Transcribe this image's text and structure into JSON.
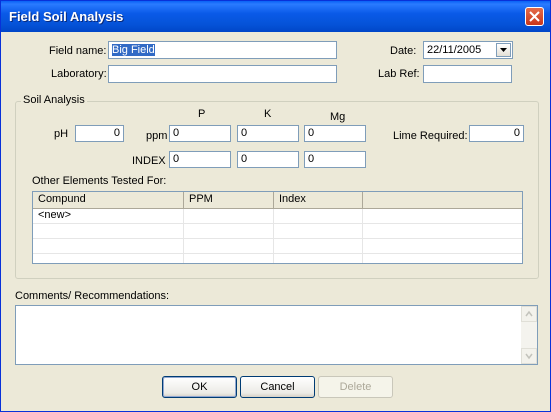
{
  "window": {
    "title": "Field Soil Analysis"
  },
  "header": {
    "field_name_label": "Field name:",
    "field_name_value": "Big Field",
    "laboratory_label": "Laboratory:",
    "laboratory_value": "",
    "date_label": "Date:",
    "date_value": "22/11/2005",
    "lab_ref_label": "Lab Ref:",
    "lab_ref_value": ""
  },
  "soil": {
    "group_label": "Soil Analysis",
    "ph_label": "pH",
    "ph_value": "0",
    "p_label": "P",
    "k_label": "K",
    "mg_label": "Mg",
    "ppm_label": "ppm",
    "index_label": "INDEX",
    "ppm_values": {
      "p": "0",
      "k": "0",
      "mg": "0"
    },
    "index_values": {
      "p": "0",
      "k": "0",
      "mg": "0"
    },
    "lime_label": "Lime Required:",
    "lime_value": "0",
    "other_label": "Other Elements Tested For:",
    "grid": {
      "columns": [
        "Compund",
        "PPM",
        "Index",
        ""
      ],
      "rows": [
        [
          "<new>",
          "",
          "",
          ""
        ],
        [
          "",
          "",
          "",
          ""
        ],
        [
          "",
          "",
          "",
          ""
        ],
        [
          "",
          "",
          "",
          ""
        ]
      ]
    }
  },
  "comments": {
    "label": "Comments/ Recommendations:",
    "value": ""
  },
  "buttons": {
    "ok": "OK",
    "cancel": "Cancel",
    "delete": "Delete"
  }
}
